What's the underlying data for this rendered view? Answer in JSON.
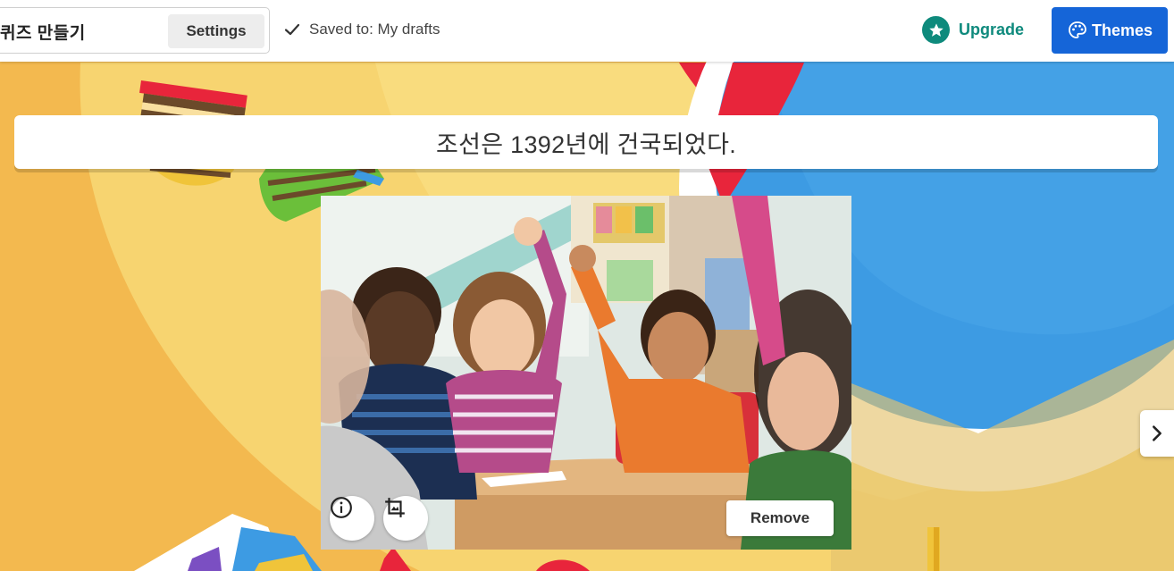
{
  "header": {
    "quiz_title": "퀴즈 만들기",
    "settings_label": "Settings",
    "saved_status": "Saved to: My drafts",
    "upgrade_label": "Upgrade",
    "themes_label": "Themes"
  },
  "question": {
    "text": "조선은 1392년에 건국되었다."
  },
  "image_controls": {
    "remove_label": "Remove",
    "info_icon": "info-icon",
    "crop_icon": "crop-icon"
  },
  "navigation": {
    "next_icon": "chevron-right-icon"
  },
  "colors": {
    "brand_blue": "#1565d8",
    "upgrade_teal": "#0e8a7c",
    "background_yellow": "#f3b94f"
  }
}
